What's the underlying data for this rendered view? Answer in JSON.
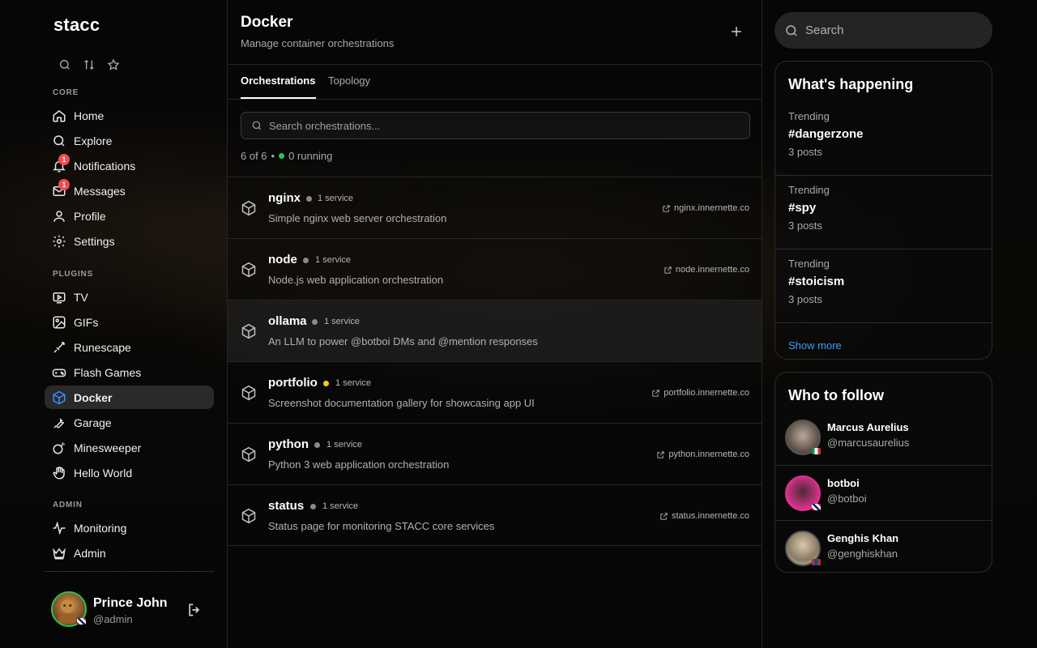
{
  "app": {
    "logo": "stacc"
  },
  "sidebar": {
    "quick_icons": [
      "search-icon",
      "sort-icon",
      "star-icon"
    ],
    "sections": {
      "core": "CORE",
      "plugins": "PLUGINS",
      "admin": "ADMIN"
    },
    "core_items": [
      {
        "label": "Home",
        "icon": "home-icon"
      },
      {
        "label": "Explore",
        "icon": "search-icon"
      },
      {
        "label": "Notifications",
        "icon": "bell-icon",
        "badge": "1"
      },
      {
        "label": "Messages",
        "icon": "mail-icon",
        "badge": "1"
      },
      {
        "label": "Profile",
        "icon": "user-icon"
      },
      {
        "label": "Settings",
        "icon": "gear-icon"
      }
    ],
    "plugin_items": [
      {
        "label": "TV",
        "icon": "tv-icon"
      },
      {
        "label": "GIFs",
        "icon": "gif-icon"
      },
      {
        "label": "Runescape",
        "icon": "sword-icon"
      },
      {
        "label": "Flash Games",
        "icon": "gamepad-icon"
      },
      {
        "label": "Docker",
        "icon": "docker-box-icon",
        "active": true
      },
      {
        "label": "Garage",
        "icon": "wrench-icon"
      },
      {
        "label": "Minesweeper",
        "icon": "bomb-icon"
      },
      {
        "label": "Hello World",
        "icon": "hand-icon"
      }
    ],
    "admin_items": [
      {
        "label": "Monitoring",
        "icon": "activity-icon"
      },
      {
        "label": "Admin",
        "icon": "crown-icon"
      }
    ],
    "user": {
      "name": "Prince John",
      "handle": "@admin"
    }
  },
  "main": {
    "title": "Docker",
    "subtitle": "Manage container orchestrations",
    "tabs": [
      "Orchestrations",
      "Topology"
    ],
    "search_placeholder": "Search orchestrations...",
    "count_text": "6 of 6",
    "separator": "•",
    "running_text": "0 running",
    "accent_green": "#22c55e",
    "accent_blue": "#3b8cff",
    "orchestrations": [
      {
        "name": "nginx",
        "status_color": "#8a8a8a",
        "services": "1 service",
        "description": "Simple nginx web server orchestration",
        "url": "nginx.innernette.co"
      },
      {
        "name": "node",
        "status_color": "#8a8a8a",
        "services": "1 service",
        "description": "Node.js web application orchestration",
        "url": "node.innernette.co"
      },
      {
        "name": "ollama",
        "status_color": "#8a8a8a",
        "services": "1 service",
        "description": "An LLM to power @botboi DMs and @mention responses",
        "url": ""
      },
      {
        "name": "portfolio",
        "status_color": "#facc15",
        "services": "1 service",
        "description": "Screenshot documentation gallery for showcasing app UI",
        "url": "portfolio.innernette.co"
      },
      {
        "name": "python",
        "status_color": "#8a8a8a",
        "services": "1 service",
        "description": "Python 3 web application orchestration",
        "url": "python.innernette.co"
      },
      {
        "name": "status",
        "status_color": "#8a8a8a",
        "services": "1 service",
        "description": "Status page for monitoring STACC core services",
        "url": "status.innernette.co"
      }
    ]
  },
  "right": {
    "search_placeholder": "Search",
    "happening": {
      "title": "What's happening",
      "items": [
        {
          "label": "Trending",
          "tag": "#dangerzone",
          "posts": "3 posts"
        },
        {
          "label": "Trending",
          "tag": "#spy",
          "posts": "3 posts"
        },
        {
          "label": "Trending",
          "tag": "#stoicism",
          "posts": "3 posts"
        }
      ],
      "show_more": "Show more"
    },
    "follow": {
      "title": "Who to follow",
      "users": [
        {
          "name": "Marcus Aurelius",
          "handle": "@marcusaurelius"
        },
        {
          "name": "botboi",
          "handle": "@botboi"
        },
        {
          "name": "Genghis Khan",
          "handle": "@genghiskhan"
        }
      ]
    }
  }
}
